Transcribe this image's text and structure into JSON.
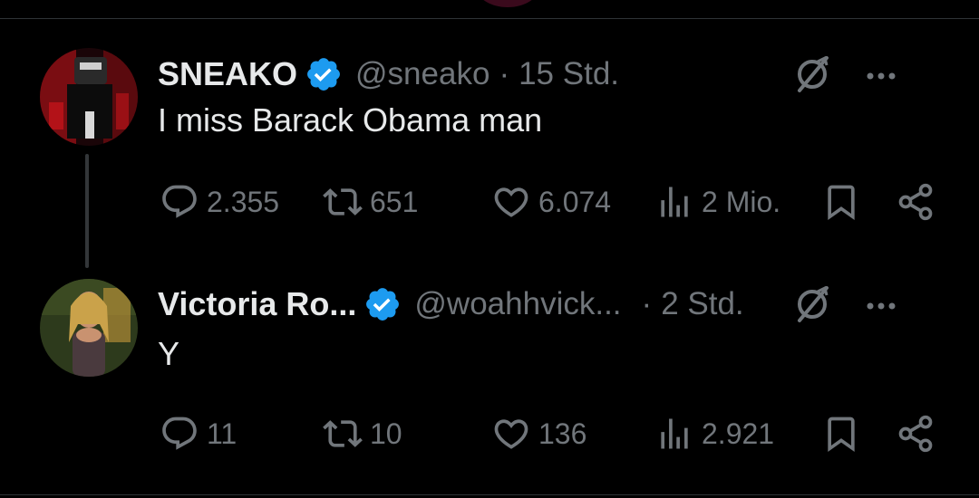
{
  "posts": [
    {
      "author_name": "SNEAKO",
      "verified": true,
      "handle": "@sneako",
      "separator": "·",
      "time": "15 Std.",
      "text": "I miss Barack Obama man",
      "stats": {
        "replies": "2.355",
        "reposts": "651",
        "likes": "6.074",
        "views": "2 Mio."
      }
    },
    {
      "author_name": "Victoria Ro...",
      "verified": true,
      "handle": "@woahhvick...",
      "separator": "·",
      "time": "2 Std.",
      "text": "Y",
      "stats": {
        "replies": "11",
        "reposts": "10",
        "likes": "136",
        "views": "2.921"
      }
    }
  ],
  "colors": {
    "background": "#000000",
    "primary_text": "#e7e9ea",
    "secondary_text": "#71767b",
    "verified_blue": "#1d9bf0",
    "divider": "#2f3336"
  },
  "icons": {
    "reply": "reply-icon",
    "repost": "repost-icon",
    "like": "heart-icon",
    "views": "views-icon",
    "bookmark": "bookmark-icon",
    "share": "share-icon",
    "grok": "grok-icon",
    "more": "more-icon",
    "verified": "verified-badge-icon"
  }
}
